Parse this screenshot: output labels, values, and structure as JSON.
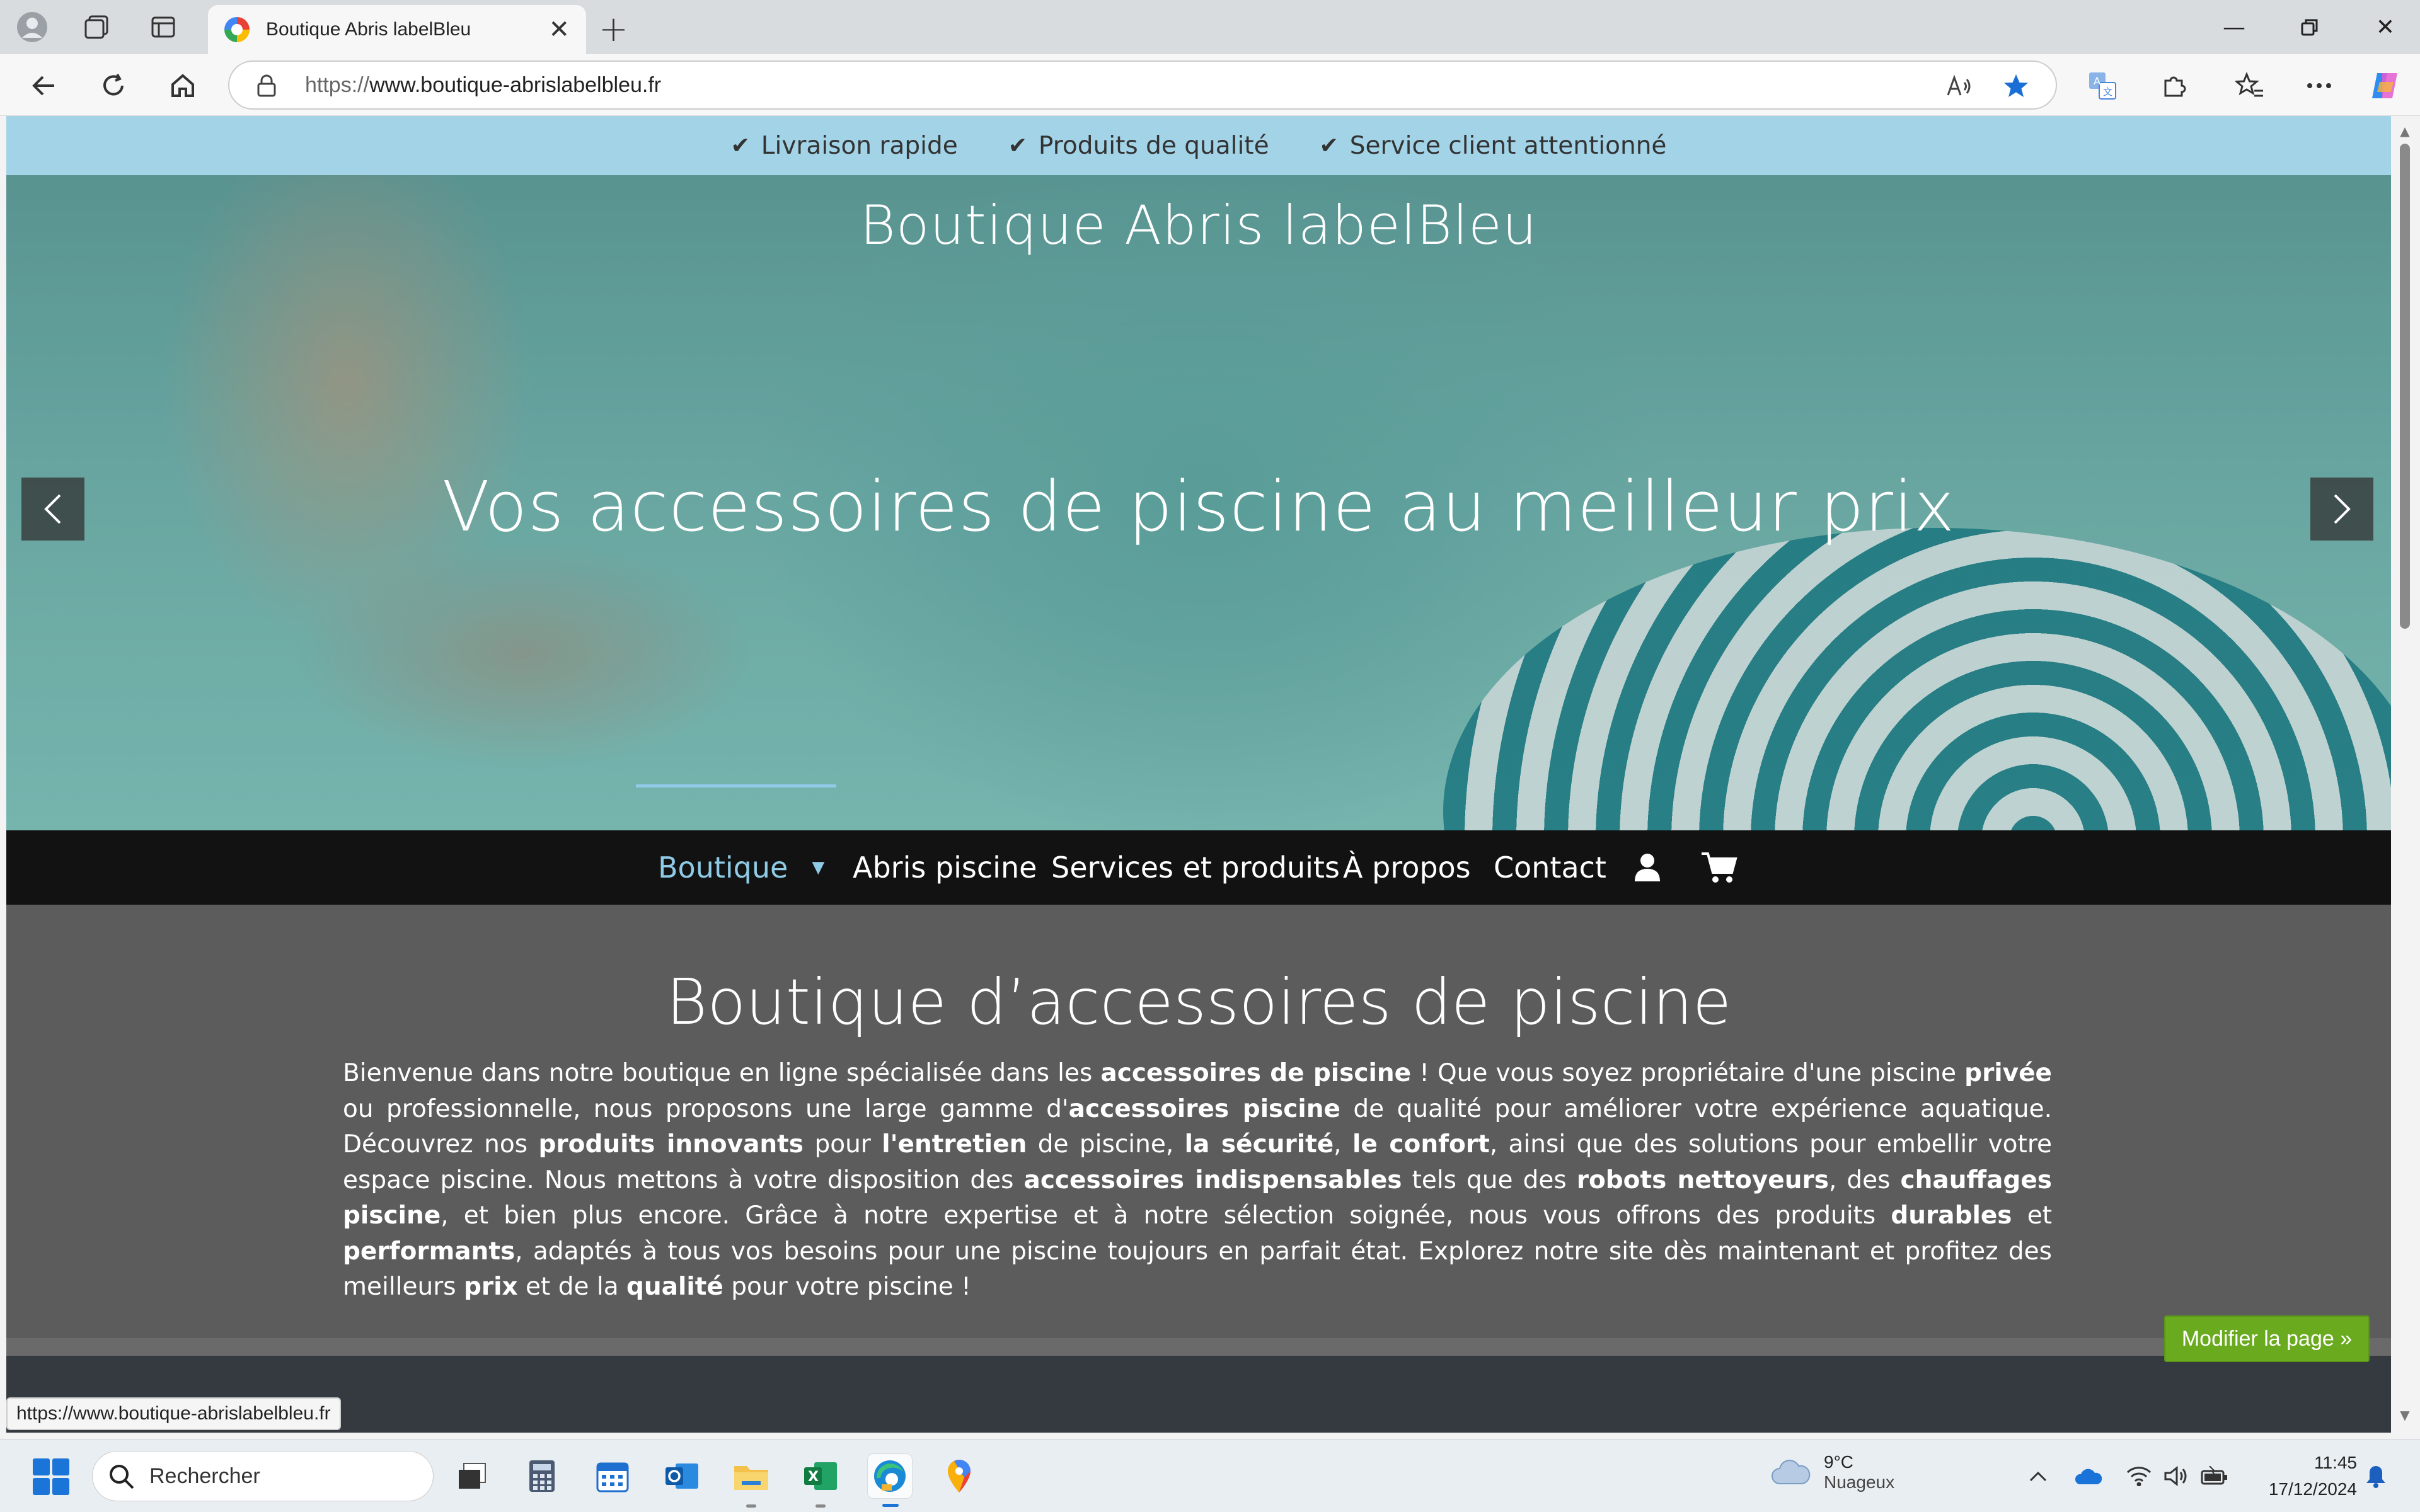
{
  "browser": {
    "tab_title": "Boutique Abris labelBleu",
    "url_protocol": "https://",
    "url_host": "www.boutique-abrislabelbleu.fr",
    "status_url": "https://www.boutique-abrislabelbleu.fr"
  },
  "page": {
    "topstrip": [
      {
        "label": "Livraison rapide"
      },
      {
        "label": "Produits de qualité"
      },
      {
        "label": "Service client attentionné"
      }
    ],
    "site_title": "Boutique Abris labelBleu",
    "tagline": "Vos accessoires de piscine au meilleur prix",
    "nav": {
      "boutique": "Boutique",
      "abris": "Abris piscine",
      "services": "Services et produits",
      "apropos": "À propos",
      "contact": "Contact"
    },
    "heading": "Boutique d’accessoires de piscine",
    "intro": [
      {
        "t": "Bienvenue dans notre boutique en ligne spécialisée dans les "
      },
      {
        "b": "accessoires de piscine"
      },
      {
        "t": " ! Que vous soyez propriétaire d'une piscine "
      },
      {
        "b": "privée"
      },
      {
        "t": " ou professionnelle, nous proposons une large gamme d'"
      },
      {
        "b": "accessoires piscine"
      },
      {
        "t": " de qualité pour améliorer votre expérience aquatique. Découvrez nos "
      },
      {
        "b": "produits innovants"
      },
      {
        "t": " pour "
      },
      {
        "b": "l'entretien"
      },
      {
        "t": " de piscine, "
      },
      {
        "b": "la sécurité"
      },
      {
        "t": ", "
      },
      {
        "b": "le confort"
      },
      {
        "t": ", ainsi que des solutions pour embellir votre espace piscine. Nous mettons à votre disposition des "
      },
      {
        "b": "accessoires indispensables"
      },
      {
        "t": " tels que des "
      },
      {
        "b": "robots nettoyeurs"
      },
      {
        "t": ", des "
      },
      {
        "b": "chauffages piscine"
      },
      {
        "t": ", et bien plus encore. Grâce à notre expertise et à notre sélection soignée, nous vous offrons des produits "
      },
      {
        "b": "durables"
      },
      {
        "t": " et "
      },
      {
        "b": "performants"
      },
      {
        "t": ", adaptés à tous vos besoins pour une piscine toujours en parfait état. Explorez notre site dès maintenant et profitez des meilleurs "
      },
      {
        "b": "prix"
      },
      {
        "t": " et de la "
      },
      {
        "b": "qualité"
      },
      {
        "t": " pour votre piscine !"
      }
    ],
    "edit_button": "Modifier la page »"
  },
  "taskbar": {
    "search_placeholder": "Rechercher",
    "weather_temp": "9°C",
    "weather_desc": "Nuageux",
    "time": "11:45",
    "date": "17/12/2024"
  },
  "colors": {
    "topstrip_bg": "#a2d3e7",
    "nav_active": "#8fcbe6",
    "edit_button_bg": "#6aaa1e",
    "content_bg": "#5c5c5c"
  }
}
